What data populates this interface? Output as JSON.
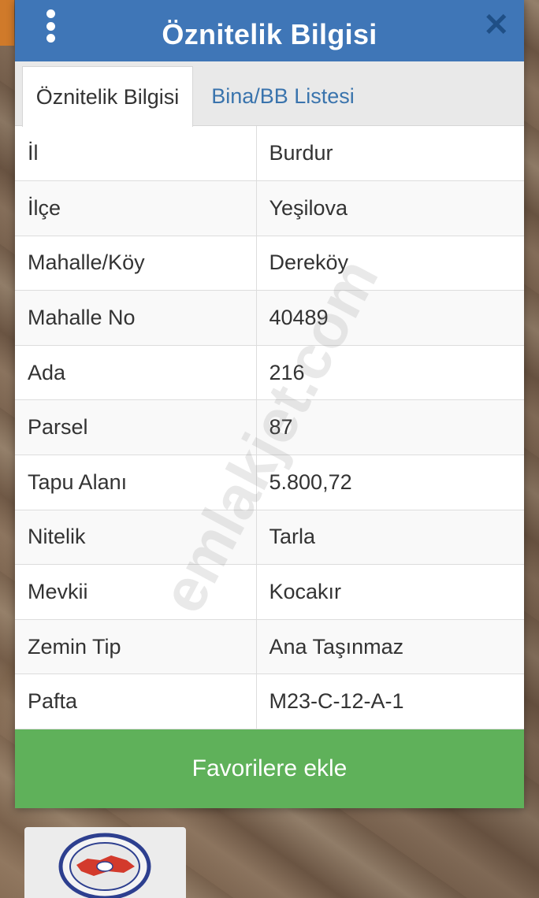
{
  "dialog": {
    "title": "Öznitelik Bilgisi",
    "close_glyph": "✕",
    "menu_icon": "kebab-menu-icon",
    "close_icon": "close-icon"
  },
  "tabs": [
    {
      "label": "Öznitelik Bilgisi",
      "active": true
    },
    {
      "label": "Bina/BB Listesi",
      "active": false
    }
  ],
  "attributes": [
    {
      "key": "İl",
      "value": "Burdur"
    },
    {
      "key": "İlçe",
      "value": "Yeşilova"
    },
    {
      "key": "Mahalle/Köy",
      "value": "Dereköy"
    },
    {
      "key": "Mahalle No",
      "value": "40489"
    },
    {
      "key": "Ada",
      "value": "216"
    },
    {
      "key": "Parsel",
      "value": "87"
    },
    {
      "key": "Tapu Alanı",
      "value": "5.800,72"
    },
    {
      "key": "Nitelik",
      "value": "Tarla"
    },
    {
      "key": "Mevkii",
      "value": "Kocakır"
    },
    {
      "key": "Zemin Tip",
      "value": "Ana Taşınmaz"
    },
    {
      "key": "Pafta",
      "value": "M23-C-12-A-1"
    }
  ],
  "actions": {
    "favorite_label": "Favorilere ekle"
  },
  "watermark": "emlakjet.com",
  "colors": {
    "header": "#3f76b7",
    "tab_link": "#3a74ad",
    "favorite_button": "#5fb15a"
  }
}
